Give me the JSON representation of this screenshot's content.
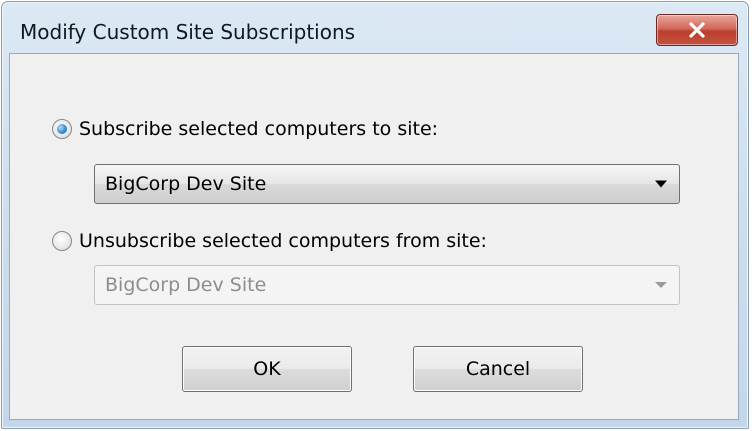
{
  "window": {
    "title": "Modify Custom Site Subscriptions",
    "close_glyph": "X"
  },
  "subscribe": {
    "label": "Subscribe selected computers to site:",
    "selected": true,
    "site_value": "BigCorp Dev Site"
  },
  "unsubscribe": {
    "label": "Unsubscribe selected computers from site:",
    "selected": false,
    "site_value": "BigCorp Dev Site"
  },
  "buttons": {
    "ok": "OK",
    "cancel": "Cancel"
  },
  "colors": {
    "close_button": "#c4533f",
    "radio_selected": "#3b8ed0"
  }
}
